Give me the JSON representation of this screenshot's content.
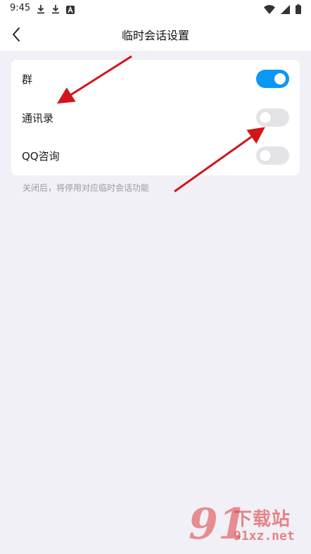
{
  "status_bar": {
    "time": "9:45",
    "left_icons": [
      "download-icon",
      "download-icon",
      "app-a-icon"
    ],
    "right_icons": [
      "wifi-icon",
      "signal-icon",
      "battery-icon"
    ]
  },
  "nav": {
    "title": "临时会话设置",
    "back_icon": "chevron-left-icon"
  },
  "settings": {
    "items": [
      {
        "label": "群",
        "enabled": true
      },
      {
        "label": "通讯录",
        "enabled": false
      },
      {
        "label": "QQ咨询",
        "enabled": false
      }
    ],
    "footnote": "关闭后，将停用对应临时会话功能"
  },
  "colors": {
    "page_background": "#f1f0f6",
    "toggle_on": "#0a97f6",
    "toggle_off": "#e4e4e8",
    "annotation_arrow": "#d0161b"
  },
  "watermark": {
    "logo": "91",
    "title": "下载站",
    "url": "91xz.net"
  }
}
